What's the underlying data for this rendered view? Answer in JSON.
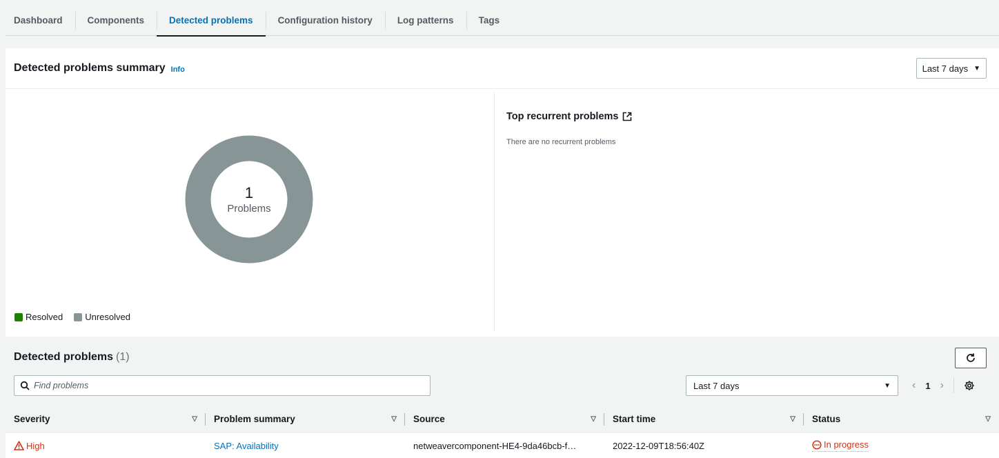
{
  "tabs": [
    "Dashboard",
    "Components",
    "Detected problems",
    "Configuration history",
    "Log patterns",
    "Tags"
  ],
  "active_tab": "Detected problems",
  "summary": {
    "title": "Detected problems summary",
    "info_label": "Info",
    "range_select": "Last 7 days",
    "donut": {
      "count": "1",
      "label": "Problems",
      "resolved": 0,
      "unresolved": 1,
      "resolved_color": "#1d8102",
      "unresolved_color": "#879596"
    },
    "legend": {
      "resolved": "Resolved",
      "unresolved": "Unresolved"
    },
    "recurrent_title": "Top recurrent problems",
    "recurrent_empty": "There are no recurrent problems"
  },
  "problems": {
    "title": "Detected problems",
    "count": "(1)",
    "search_placeholder": "Find problems",
    "range_select": "Last 7 days",
    "page": "1",
    "columns": [
      "Severity",
      "Problem summary",
      "Source",
      "Start time",
      "Status"
    ],
    "rows": [
      {
        "severity": "High",
        "summary": "SAP: Availability",
        "source": "netweavercomponent-HE4-9da46bcb-f…",
        "start_time": "2022-12-09T18:56:40Z",
        "status": "In progress"
      }
    ]
  },
  "colors": {
    "accent": "#0073bb",
    "error": "#d13212"
  }
}
